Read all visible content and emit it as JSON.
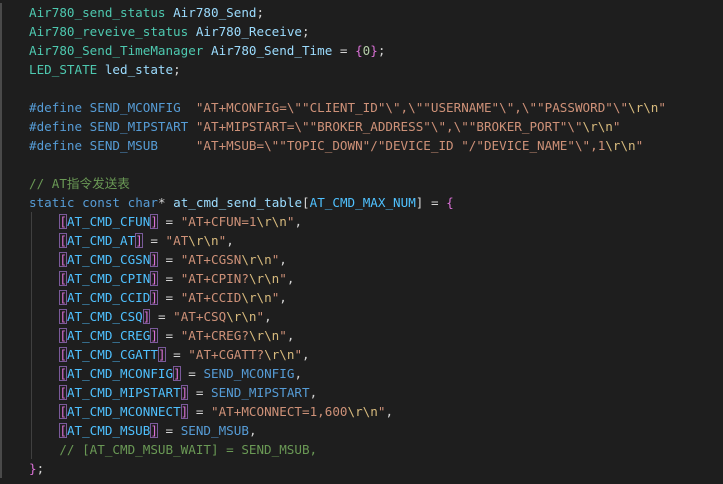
{
  "colors": {
    "background": "#1e1e1e",
    "type": "#4ec9b0",
    "variable": "#9cdcfe",
    "keyword": "#569cd6",
    "string": "#ce9178",
    "escape": "#d7ba7d",
    "comment": "#6a9955",
    "number": "#b5cea8",
    "brace": "#da70d6",
    "enum_constant": "#4fc1ff"
  },
  "lines": [
    [
      [
        "type",
        "Air780_send_status"
      ],
      [
        "plain",
        " "
      ],
      [
        "var",
        "Air780_Send"
      ],
      [
        "plain",
        ";"
      ]
    ],
    [
      [
        "type",
        "Air780_reveive_status"
      ],
      [
        "plain",
        " "
      ],
      [
        "var",
        "Air780_Receive"
      ],
      [
        "plain",
        ";"
      ]
    ],
    [
      [
        "type",
        "Air780_Send_TimeManager"
      ],
      [
        "plain",
        " "
      ],
      [
        "var",
        "Air780_Send_Time"
      ],
      [
        "plain",
        " = "
      ],
      [
        "brace",
        "{"
      ],
      [
        "num",
        "0"
      ],
      [
        "brace",
        "}"
      ],
      [
        "plain",
        ";"
      ]
    ],
    [
      [
        "type",
        "LED_STATE"
      ],
      [
        "plain",
        " "
      ],
      [
        "var",
        "led_state"
      ],
      [
        "plain",
        ";"
      ]
    ],
    [],
    [
      [
        "macro",
        "#define"
      ],
      [
        "plain",
        " "
      ],
      [
        "macroname",
        "SEND_MCONFIG"
      ],
      [
        "plain",
        "  "
      ],
      [
        "str",
        "\"AT+MCONFIG=\\\"\"CLIENT_ID\"\\\",\\\"\"USERNAME\"\\\",\\\"\"PASSWORD\"\\\""
      ],
      [
        "esc",
        "\\r\\n"
      ],
      [
        "str",
        "\""
      ]
    ],
    [
      [
        "macro",
        "#define"
      ],
      [
        "plain",
        " "
      ],
      [
        "macroname",
        "SEND_MIPSTART"
      ],
      [
        "plain",
        " "
      ],
      [
        "str",
        "\"AT+MIPSTART=\\\"\"BROKER_ADDRESS\"\\\",\\\"\"BROKER_PORT\"\\\""
      ],
      [
        "esc",
        "\\r\\n"
      ],
      [
        "str",
        "\""
      ]
    ],
    [
      [
        "macro",
        "#define"
      ],
      [
        "plain",
        " "
      ],
      [
        "macroname",
        "SEND_MSUB"
      ],
      [
        "plain",
        "     "
      ],
      [
        "str",
        "\"AT+MSUB=\\\"\"TOPIC_DOWN\"/\"DEVICE_ID \"/\"DEVICE_NAME\"\\\",1"
      ],
      [
        "esc",
        "\\r\\n"
      ],
      [
        "str",
        "\""
      ]
    ],
    [],
    [
      [
        "comment",
        "// AT指令发送表"
      ]
    ],
    [
      [
        "kw",
        "static"
      ],
      [
        "plain",
        " "
      ],
      [
        "kw",
        "const"
      ],
      [
        "plain",
        " "
      ],
      [
        "kw",
        "char"
      ],
      [
        "plain",
        "* "
      ],
      [
        "var",
        "at_cmd_send_table"
      ],
      [
        "plain",
        "["
      ],
      [
        "enum",
        "AT_CMD_MAX_NUM"
      ],
      [
        "plain",
        "] = "
      ],
      [
        "brace",
        "{"
      ]
    ],
    [
      [
        "plain",
        "    "
      ],
      [
        "bracket",
        "["
      ],
      [
        "enum",
        "AT_CMD_CFUN"
      ],
      [
        "bracket",
        "]"
      ],
      [
        "plain",
        " = "
      ],
      [
        "str",
        "\"AT+CFUN=1"
      ],
      [
        "esc",
        "\\r\\n"
      ],
      [
        "str",
        "\""
      ],
      [
        "plain",
        ","
      ]
    ],
    [
      [
        "plain",
        "    "
      ],
      [
        "bracket",
        "["
      ],
      [
        "enum",
        "AT_CMD_AT"
      ],
      [
        "bracket",
        "]"
      ],
      [
        "plain",
        " = "
      ],
      [
        "str",
        "\"AT"
      ],
      [
        "esc",
        "\\r\\n"
      ],
      [
        "str",
        "\""
      ],
      [
        "plain",
        ","
      ]
    ],
    [
      [
        "plain",
        "    "
      ],
      [
        "bracket",
        "["
      ],
      [
        "enum",
        "AT_CMD_CGSN"
      ],
      [
        "bracket",
        "]"
      ],
      [
        "plain",
        " = "
      ],
      [
        "str",
        "\"AT+CGSN"
      ],
      [
        "esc",
        "\\r\\n"
      ],
      [
        "str",
        "\""
      ],
      [
        "plain",
        ","
      ]
    ],
    [
      [
        "plain",
        "    "
      ],
      [
        "bracket",
        "["
      ],
      [
        "enum",
        "AT_CMD_CPIN"
      ],
      [
        "bracket",
        "]"
      ],
      [
        "plain",
        " = "
      ],
      [
        "str",
        "\"AT+CPIN?"
      ],
      [
        "esc",
        "\\r\\n"
      ],
      [
        "str",
        "\""
      ],
      [
        "plain",
        ","
      ]
    ],
    [
      [
        "plain",
        "    "
      ],
      [
        "bracket",
        "["
      ],
      [
        "enum",
        "AT_CMD_CCID"
      ],
      [
        "bracket",
        "]"
      ],
      [
        "plain",
        " = "
      ],
      [
        "str",
        "\"AT+CCID"
      ],
      [
        "esc",
        "\\r\\n"
      ],
      [
        "str",
        "\""
      ],
      [
        "plain",
        ","
      ]
    ],
    [
      [
        "plain",
        "    "
      ],
      [
        "bracket",
        "["
      ],
      [
        "enum",
        "AT_CMD_CSQ"
      ],
      [
        "bracket",
        "]"
      ],
      [
        "plain",
        " = "
      ],
      [
        "str",
        "\"AT+CSQ"
      ],
      [
        "esc",
        "\\r\\n"
      ],
      [
        "str",
        "\""
      ],
      [
        "plain",
        ","
      ]
    ],
    [
      [
        "plain",
        "    "
      ],
      [
        "bracket",
        "["
      ],
      [
        "enum",
        "AT_CMD_CREG"
      ],
      [
        "bracket",
        "]"
      ],
      [
        "plain",
        " = "
      ],
      [
        "str",
        "\"AT+CREG?"
      ],
      [
        "esc",
        "\\r\\n"
      ],
      [
        "str",
        "\""
      ],
      [
        "plain",
        ","
      ]
    ],
    [
      [
        "plain",
        "    "
      ],
      [
        "bracket",
        "["
      ],
      [
        "enum",
        "AT_CMD_CGATT"
      ],
      [
        "bracket",
        "]"
      ],
      [
        "plain",
        " = "
      ],
      [
        "str",
        "\"AT+CGATT?"
      ],
      [
        "esc",
        "\\r\\n"
      ],
      [
        "str",
        "\""
      ],
      [
        "plain",
        ","
      ]
    ],
    [
      [
        "plain",
        "    "
      ],
      [
        "bracket",
        "["
      ],
      [
        "enum",
        "AT_CMD_MCONFIG"
      ],
      [
        "bracket",
        "]"
      ],
      [
        "plain",
        " = "
      ],
      [
        "macroname",
        "SEND_MCONFIG"
      ],
      [
        "plain",
        ","
      ]
    ],
    [
      [
        "plain",
        "    "
      ],
      [
        "bracket",
        "["
      ],
      [
        "enum",
        "AT_CMD_MIPSTART"
      ],
      [
        "bracket",
        "]"
      ],
      [
        "plain",
        " = "
      ],
      [
        "macroname",
        "SEND_MIPSTART"
      ],
      [
        "plain",
        ","
      ]
    ],
    [
      [
        "plain",
        "    "
      ],
      [
        "bracket",
        "["
      ],
      [
        "enum",
        "AT_CMD_MCONNECT"
      ],
      [
        "bracket",
        "]"
      ],
      [
        "plain",
        " = "
      ],
      [
        "str",
        "\"AT+MCONNECT=1,600"
      ],
      [
        "esc",
        "\\r\\n"
      ],
      [
        "str",
        "\""
      ],
      [
        "plain",
        ","
      ]
    ],
    [
      [
        "plain",
        "    "
      ],
      [
        "bracket",
        "["
      ],
      [
        "enum",
        "AT_CMD_MSUB"
      ],
      [
        "bracket",
        "]"
      ],
      [
        "plain",
        " = "
      ],
      [
        "macroname",
        "SEND_MSUB"
      ],
      [
        "plain",
        ","
      ]
    ],
    [
      [
        "plain",
        "    "
      ],
      [
        "comment",
        "// [AT_CMD_MSUB_WAIT] = SEND_MSUB,"
      ]
    ],
    [
      [
        "brace",
        "}"
      ],
      [
        "plain",
        ";"
      ]
    ]
  ]
}
